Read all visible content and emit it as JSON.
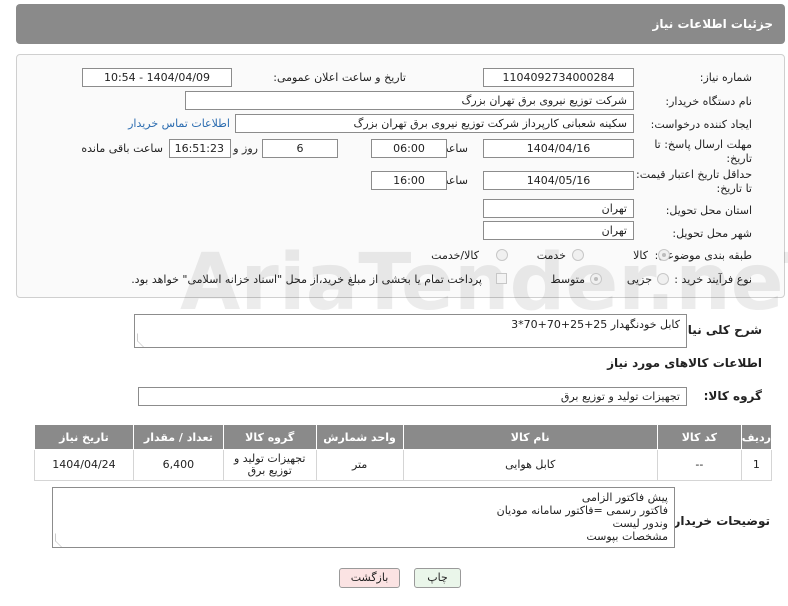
{
  "header": {
    "title": "جزئیات اطلاعات نیاز"
  },
  "form": {
    "need_number_label": "شماره نیاز:",
    "need_number": "1104092734000284",
    "announce_label": "تاریخ و ساعت اعلان عمومی:",
    "announce_value": "1404/04/09 - 10:54",
    "buyer_org_label": "نام دستگاه خریدار:",
    "buyer_org": "شرکت توزیع نیروی برق تهران بزرگ",
    "creator_label": "ایجاد کننده درخواست:",
    "creator": "سکینه شعبانی کارپرداز شرکت توزیع نیروی برق تهران بزرگ",
    "contact_link": "اطلاعات تماس خریدار",
    "reply_deadline_label_1": "مهلت ارسال پاسخ: تا",
    "reply_deadline_label_2": "تاریخ:",
    "reply_date": "1404/04/16",
    "time_label": "ساعت",
    "reply_time": "06:00",
    "days_value": "6",
    "days_label": "روز و",
    "remaining_time": "16:51:23",
    "remaining_label": "ساعت باقی مانده",
    "price_deadline_label_1": "حداقل تاریخ اعتبار قیمت:",
    "price_deadline_label_2": "تا تاریخ:",
    "price_date": "1404/05/16",
    "price_time": "16:00",
    "province_label": "استان محل تحویل:",
    "province": "تهران",
    "city_label": "شهر محل تحویل:",
    "city": "تهران",
    "category_label": "طبقه بندی موضوعی:",
    "category_options": [
      "کالا",
      "خدمت",
      "کالا/خدمت"
    ],
    "process_label": "نوع فرآیند خرید :",
    "process_options": [
      "جزیی",
      "متوسط"
    ],
    "payment_note": "پرداخت تمام یا بخشی از مبلغ خرید،از محل \"اسناد خزانه اسلامی\" خواهد بود."
  },
  "description": {
    "label": "شرح کلی نیاز:",
    "value": "کابل خودنگهدار 25+25+70+70*3"
  },
  "goods": {
    "section_title": "اطلاعات کالاهای مورد نیاز",
    "group_label": "گروه کالا:",
    "group_value": "تجهیزات تولید و توزیع برق",
    "columns": [
      "ردیف",
      "کد کالا",
      "نام کالا",
      "واحد شمارش",
      "گروه کالا",
      "تعداد / مقدار",
      "تاریخ نیاز"
    ],
    "rows": [
      [
        "1",
        "--",
        "کابل هوایی",
        "متر",
        "تجهیزات تولید و توزیع برق",
        "6,400",
        "1404/04/24"
      ]
    ]
  },
  "buyer_notes": {
    "label": "توضیحات خریدار:",
    "lines": [
      "پیش فاکتور الزامی",
      "فاکتور رسمی =فاکتور سامانه مودیان",
      "وندور لیست",
      "مشخصات بپوست"
    ]
  },
  "buttons": {
    "print": "چاپ",
    "back": "بازگشت"
  },
  "watermark_text": "AriaTender.neT"
}
